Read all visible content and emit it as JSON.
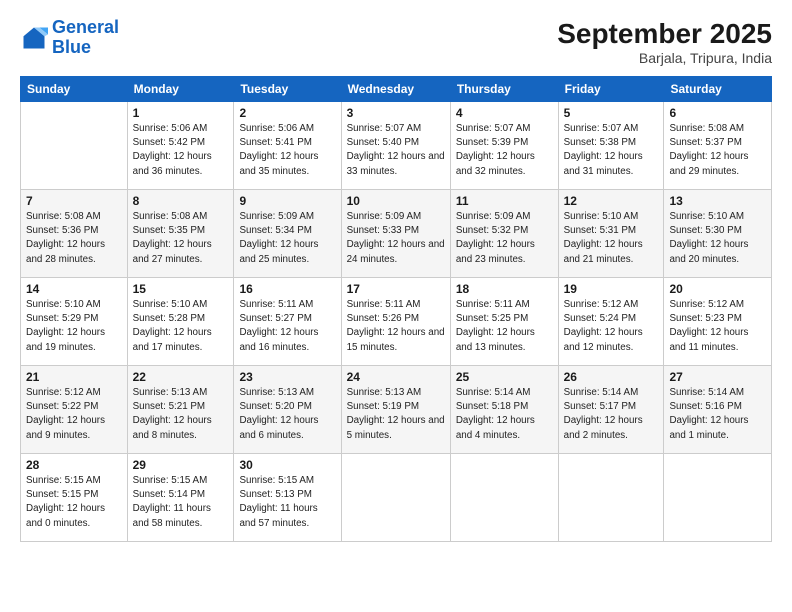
{
  "header": {
    "logo_general": "General",
    "logo_blue": "Blue",
    "month": "September 2025",
    "location": "Barjala, Tripura, India"
  },
  "days_of_week": [
    "Sunday",
    "Monday",
    "Tuesday",
    "Wednesday",
    "Thursday",
    "Friday",
    "Saturday"
  ],
  "weeks": [
    [
      {
        "day": "",
        "sunrise": "",
        "sunset": "",
        "daylight": ""
      },
      {
        "day": "1",
        "sunrise": "Sunrise: 5:06 AM",
        "sunset": "Sunset: 5:42 PM",
        "daylight": "Daylight: 12 hours and 36 minutes."
      },
      {
        "day": "2",
        "sunrise": "Sunrise: 5:06 AM",
        "sunset": "Sunset: 5:41 PM",
        "daylight": "Daylight: 12 hours and 35 minutes."
      },
      {
        "day": "3",
        "sunrise": "Sunrise: 5:07 AM",
        "sunset": "Sunset: 5:40 PM",
        "daylight": "Daylight: 12 hours and 33 minutes."
      },
      {
        "day": "4",
        "sunrise": "Sunrise: 5:07 AM",
        "sunset": "Sunset: 5:39 PM",
        "daylight": "Daylight: 12 hours and 32 minutes."
      },
      {
        "day": "5",
        "sunrise": "Sunrise: 5:07 AM",
        "sunset": "Sunset: 5:38 PM",
        "daylight": "Daylight: 12 hours and 31 minutes."
      },
      {
        "day": "6",
        "sunrise": "Sunrise: 5:08 AM",
        "sunset": "Sunset: 5:37 PM",
        "daylight": "Daylight: 12 hours and 29 minutes."
      }
    ],
    [
      {
        "day": "7",
        "sunrise": "Sunrise: 5:08 AM",
        "sunset": "Sunset: 5:36 PM",
        "daylight": "Daylight: 12 hours and 28 minutes."
      },
      {
        "day": "8",
        "sunrise": "Sunrise: 5:08 AM",
        "sunset": "Sunset: 5:35 PM",
        "daylight": "Daylight: 12 hours and 27 minutes."
      },
      {
        "day": "9",
        "sunrise": "Sunrise: 5:09 AM",
        "sunset": "Sunset: 5:34 PM",
        "daylight": "Daylight: 12 hours and 25 minutes."
      },
      {
        "day": "10",
        "sunrise": "Sunrise: 5:09 AM",
        "sunset": "Sunset: 5:33 PM",
        "daylight": "Daylight: 12 hours and 24 minutes."
      },
      {
        "day": "11",
        "sunrise": "Sunrise: 5:09 AM",
        "sunset": "Sunset: 5:32 PM",
        "daylight": "Daylight: 12 hours and 23 minutes."
      },
      {
        "day": "12",
        "sunrise": "Sunrise: 5:10 AM",
        "sunset": "Sunset: 5:31 PM",
        "daylight": "Daylight: 12 hours and 21 minutes."
      },
      {
        "day": "13",
        "sunrise": "Sunrise: 5:10 AM",
        "sunset": "Sunset: 5:30 PM",
        "daylight": "Daylight: 12 hours and 20 minutes."
      }
    ],
    [
      {
        "day": "14",
        "sunrise": "Sunrise: 5:10 AM",
        "sunset": "Sunset: 5:29 PM",
        "daylight": "Daylight: 12 hours and 19 minutes."
      },
      {
        "day": "15",
        "sunrise": "Sunrise: 5:10 AM",
        "sunset": "Sunset: 5:28 PM",
        "daylight": "Daylight: 12 hours and 17 minutes."
      },
      {
        "day": "16",
        "sunrise": "Sunrise: 5:11 AM",
        "sunset": "Sunset: 5:27 PM",
        "daylight": "Daylight: 12 hours and 16 minutes."
      },
      {
        "day": "17",
        "sunrise": "Sunrise: 5:11 AM",
        "sunset": "Sunset: 5:26 PM",
        "daylight": "Daylight: 12 hours and 15 minutes."
      },
      {
        "day": "18",
        "sunrise": "Sunrise: 5:11 AM",
        "sunset": "Sunset: 5:25 PM",
        "daylight": "Daylight: 12 hours and 13 minutes."
      },
      {
        "day": "19",
        "sunrise": "Sunrise: 5:12 AM",
        "sunset": "Sunset: 5:24 PM",
        "daylight": "Daylight: 12 hours and 12 minutes."
      },
      {
        "day": "20",
        "sunrise": "Sunrise: 5:12 AM",
        "sunset": "Sunset: 5:23 PM",
        "daylight": "Daylight: 12 hours and 11 minutes."
      }
    ],
    [
      {
        "day": "21",
        "sunrise": "Sunrise: 5:12 AM",
        "sunset": "Sunset: 5:22 PM",
        "daylight": "Daylight: 12 hours and 9 minutes."
      },
      {
        "day": "22",
        "sunrise": "Sunrise: 5:13 AM",
        "sunset": "Sunset: 5:21 PM",
        "daylight": "Daylight: 12 hours and 8 minutes."
      },
      {
        "day": "23",
        "sunrise": "Sunrise: 5:13 AM",
        "sunset": "Sunset: 5:20 PM",
        "daylight": "Daylight: 12 hours and 6 minutes."
      },
      {
        "day": "24",
        "sunrise": "Sunrise: 5:13 AM",
        "sunset": "Sunset: 5:19 PM",
        "daylight": "Daylight: 12 hours and 5 minutes."
      },
      {
        "day": "25",
        "sunrise": "Sunrise: 5:14 AM",
        "sunset": "Sunset: 5:18 PM",
        "daylight": "Daylight: 12 hours and 4 minutes."
      },
      {
        "day": "26",
        "sunrise": "Sunrise: 5:14 AM",
        "sunset": "Sunset: 5:17 PM",
        "daylight": "Daylight: 12 hours and 2 minutes."
      },
      {
        "day": "27",
        "sunrise": "Sunrise: 5:14 AM",
        "sunset": "Sunset: 5:16 PM",
        "daylight": "Daylight: 12 hours and 1 minute."
      }
    ],
    [
      {
        "day": "28",
        "sunrise": "Sunrise: 5:15 AM",
        "sunset": "Sunset: 5:15 PM",
        "daylight": "Daylight: 12 hours and 0 minutes."
      },
      {
        "day": "29",
        "sunrise": "Sunrise: 5:15 AM",
        "sunset": "Sunset: 5:14 PM",
        "daylight": "Daylight: 11 hours and 58 minutes."
      },
      {
        "day": "30",
        "sunrise": "Sunrise: 5:15 AM",
        "sunset": "Sunset: 5:13 PM",
        "daylight": "Daylight: 11 hours and 57 minutes."
      },
      {
        "day": "",
        "sunrise": "",
        "sunset": "",
        "daylight": ""
      },
      {
        "day": "",
        "sunrise": "",
        "sunset": "",
        "daylight": ""
      },
      {
        "day": "",
        "sunrise": "",
        "sunset": "",
        "daylight": ""
      },
      {
        "day": "",
        "sunrise": "",
        "sunset": "",
        "daylight": ""
      }
    ]
  ]
}
